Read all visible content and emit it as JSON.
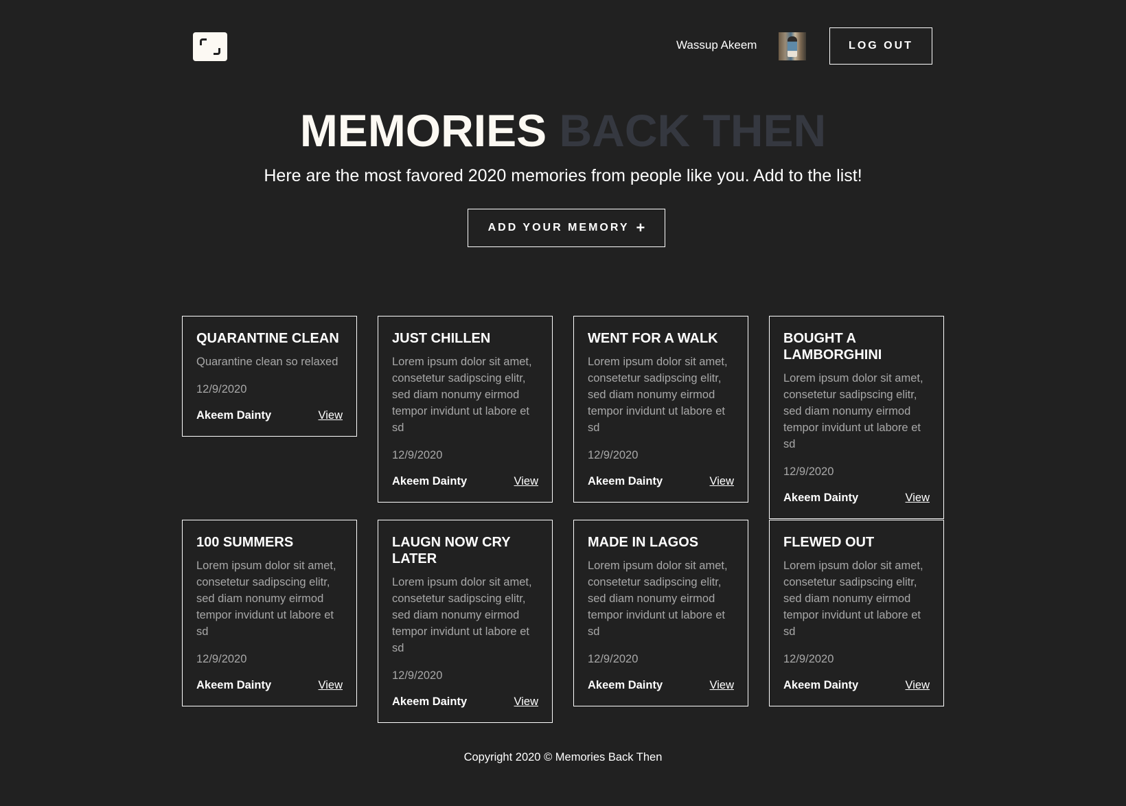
{
  "header": {
    "greeting": "Wassup Akeem",
    "logout_label": "LOG OUT"
  },
  "hero": {
    "title_primary": "MEMORIES",
    "title_secondary": "BACK THEN",
    "subtitle": "Here are the most favored 2020 memories from people like you. Add to the list!",
    "add_button_label": "ADD YOUR MEMORY",
    "add_button_icon": "+"
  },
  "cards": [
    {
      "title": "QUARANTINE CLEAN",
      "description": "Quarantine clean so relaxed",
      "date": "12/9/2020",
      "author": "Akeem Dainty",
      "view_label": "View"
    },
    {
      "title": "JUST CHILLEN",
      "description": "Lorem ipsum dolor sit amet, consetetur sadipscing elitr, sed diam nonumy eirmod tempor invidunt ut labore et sd",
      "date": "12/9/2020",
      "author": "Akeem Dainty",
      "view_label": "View"
    },
    {
      "title": "WENT FOR A WALK",
      "description": "Lorem ipsum dolor sit amet, consetetur sadipscing elitr, sed diam nonumy eirmod tempor invidunt ut labore et sd",
      "date": "12/9/2020",
      "author": "Akeem Dainty",
      "view_label": "View"
    },
    {
      "title": "BOUGHT A LAMBORGHINI",
      "description": "Lorem ipsum dolor sit amet, consetetur sadipscing elitr, sed diam nonumy eirmod tempor invidunt ut labore et sd",
      "date": "12/9/2020",
      "author": "Akeem Dainty",
      "view_label": "View"
    },
    {
      "title": "100 SUMMERS",
      "description": "Lorem ipsum dolor sit amet, consetetur sadipscing elitr, sed diam nonumy eirmod tempor invidunt ut labore et sd",
      "date": "12/9/2020",
      "author": "Akeem Dainty",
      "view_label": "View"
    },
    {
      "title": "LAUGN NOW CRY LATER",
      "description": "Lorem ipsum dolor sit amet, consetetur sadipscing elitr, sed diam nonumy eirmod tempor invidunt ut labore et sd",
      "date": "12/9/2020",
      "author": "Akeem Dainty",
      "view_label": "View"
    },
    {
      "title": "MADE IN LAGOS",
      "description": "Lorem ipsum dolor sit amet, consetetur sadipscing elitr, sed diam nonumy eirmod tempor invidunt ut labore et sd",
      "date": "12/9/2020",
      "author": "Akeem Dainty",
      "view_label": "View"
    },
    {
      "title": "FLEWED OUT",
      "description": "Lorem ipsum dolor sit amet, consetetur sadipscing elitr, sed diam nonumy eirmod tempor invidunt ut labore et sd",
      "date": "12/9/2020",
      "author": "Akeem Dainty",
      "view_label": "View"
    }
  ],
  "footer": {
    "copyright": "Copyright 2020 © Memories Back Then"
  },
  "colors": {
    "background": "#212121",
    "text": "#ffffff",
    "muted_text": "#a8a8a8",
    "title_secondary": "#353840",
    "logo_bg": "#fcf9f3"
  },
  "icons": {
    "logo": "brackets-logo-icon",
    "add": "plus-icon"
  }
}
